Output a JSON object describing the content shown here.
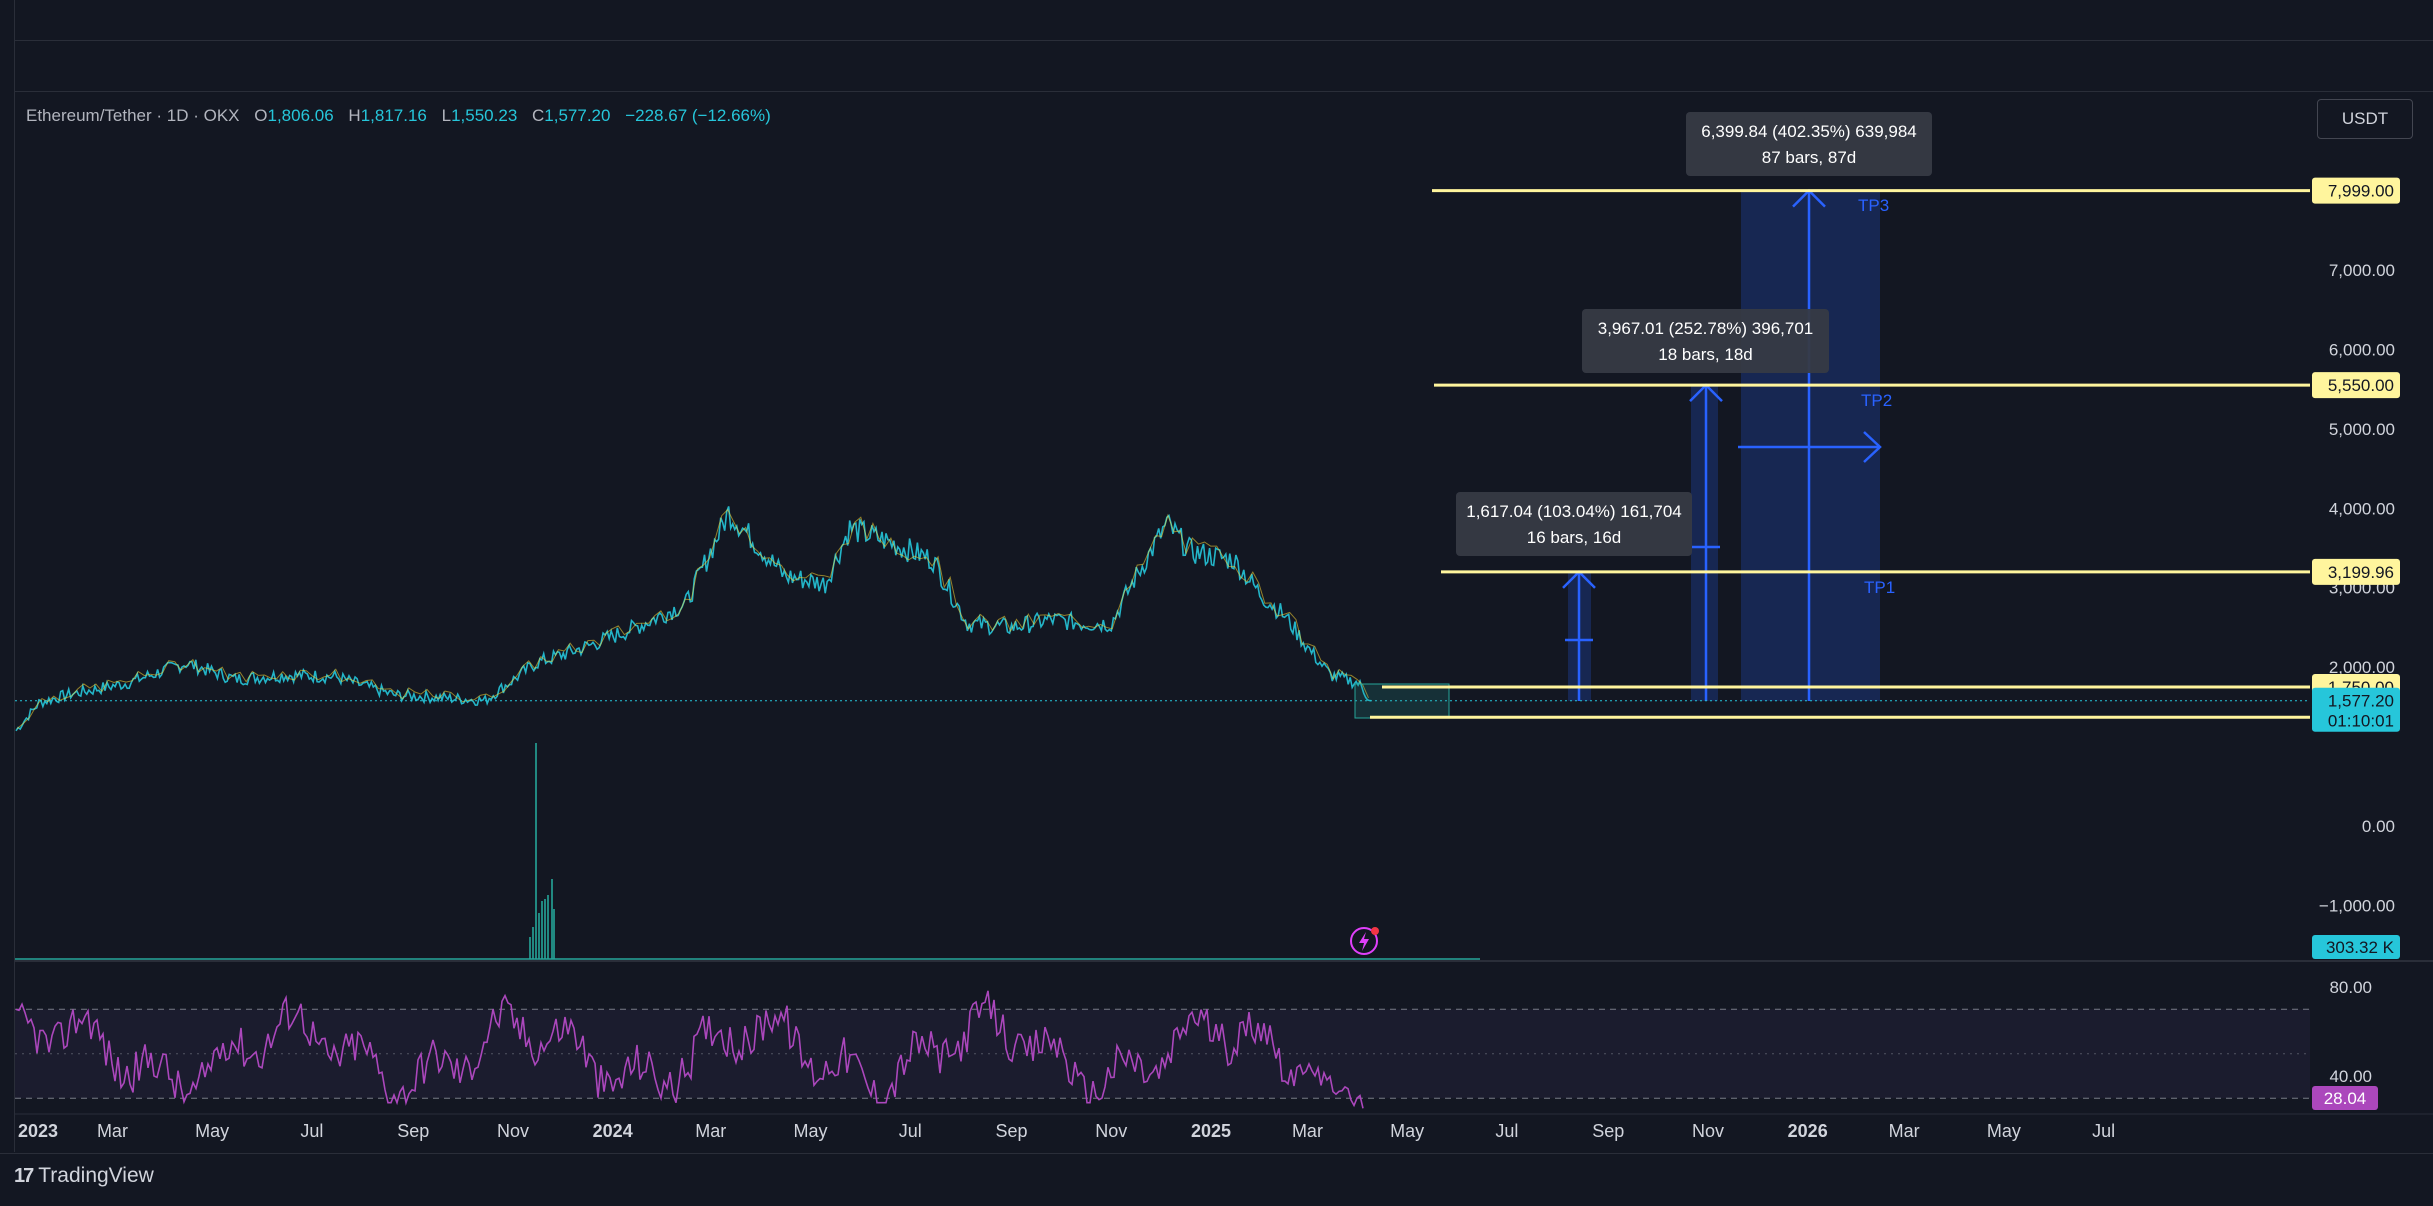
{
  "header": {
    "symbol": "Ethereum/Tether · 1D · OKX",
    "open_label": "O",
    "open": "1,806.06",
    "high_label": "H",
    "high": "1,817.16",
    "low_label": "L",
    "low": "1,550.23",
    "close_label": "C",
    "close": "1,577.20",
    "change": "−228.67 (−12.66%)"
  },
  "currency_button": "USDT",
  "brand": {
    "logo": "17",
    "name": "TradingView"
  },
  "colors": {
    "background": "#131722",
    "level_line": "#fff59d",
    "projection": "#2962ff",
    "rsi": "#ab47bc",
    "price_tag": "#26c6da",
    "grid": "#2a2e39"
  },
  "chart_data": {
    "type": "line",
    "symbol": "Ethereum/Tether",
    "interval": "1D",
    "exchange": "OKX",
    "x_tick_labels": [
      "2023",
      "Mar",
      "May",
      "Jul",
      "Sep",
      "Nov",
      "2024",
      "Mar",
      "May",
      "Jul",
      "Sep",
      "Nov",
      "2025",
      "Mar",
      "May",
      "Jul",
      "Sep",
      "Nov",
      "2026",
      "Mar",
      "May",
      "Jul"
    ],
    "y_tick_labels": [
      "7,000.00",
      "6,000.00",
      "5,000.00",
      "4,000.00",
      "3,000.00",
      "2,000.00",
      "0.00",
      "−1,000.00"
    ],
    "y_ticks": [
      7000,
      6000,
      5000,
      4000,
      3000,
      2000,
      0,
      -1000
    ],
    "price_series": {
      "x": [
        "2023-01-01",
        "2023-01-15",
        "2023-02-01",
        "2023-03-10",
        "2023-04-15",
        "2023-05-15",
        "2023-06-15",
        "2023-07-15",
        "2023-08-20",
        "2023-09-15",
        "2023-10-15",
        "2023-11-15",
        "2023-12-15",
        "2024-01-15",
        "2024-02-15",
        "2024-03-12",
        "2024-04-15",
        "2024-05-10",
        "2024-05-25",
        "2024-06-15",
        "2024-07-15",
        "2024-08-05",
        "2024-09-01",
        "2024-09-25",
        "2024-10-15",
        "2024-11-01",
        "2024-11-15",
        "2024-12-05",
        "2024-12-20",
        "2025-01-15",
        "2025-02-01",
        "2025-02-15",
        "2025-03-01",
        "2025-03-15",
        "2025-04-01",
        "2025-04-09"
      ],
      "close": [
        1200,
        1550,
        1650,
        1800,
        2050,
        1850,
        1900,
        1880,
        1650,
        1620,
        1580,
        2050,
        2250,
        2500,
        2800,
        3950,
        3150,
        3050,
        3750,
        3600,
        3350,
        2550,
        2500,
        2600,
        2550,
        2550,
        3100,
        3800,
        3450,
        3350,
        2900,
        2650,
        2250,
        1900,
        1800,
        1577
      ]
    },
    "levels": [
      {
        "value": 7999,
        "label": "7,999.00",
        "target": "TP3"
      },
      {
        "value": 5550,
        "label": "5,550.00",
        "target": "TP2"
      },
      {
        "value": 3199.96,
        "label": "3,199.96",
        "target": "TP1"
      },
      {
        "value": 1750,
        "label": "1,750.00",
        "target": ""
      },
      {
        "value": 1369,
        "label": "1,369.00",
        "target": ""
      }
    ],
    "target_labels": [
      "TP3",
      "TP2",
      "TP1"
    ],
    "measurements": [
      {
        "line1": "6,399.84 (402.35%) 639,984",
        "line2": "87 bars, 87d"
      },
      {
        "line1": "3,967.01 (252.78%) 396,701",
        "line2": "18 bars, 18d"
      },
      {
        "line1": "1,617.04 (103.04%) 161,704",
        "line2": "16 bars, 16d"
      }
    ],
    "last_price": {
      "value": 1577.2,
      "label": "1,577.20",
      "countdown": "01:10:01"
    },
    "volume": {
      "last_label": "303.32 K",
      "last": 303320
    },
    "rsi": {
      "last": 28.04,
      "last_label": "28.04",
      "levels": [
        80,
        40
      ],
      "level_labels": [
        "80.00",
        "40.00"
      ]
    }
  }
}
